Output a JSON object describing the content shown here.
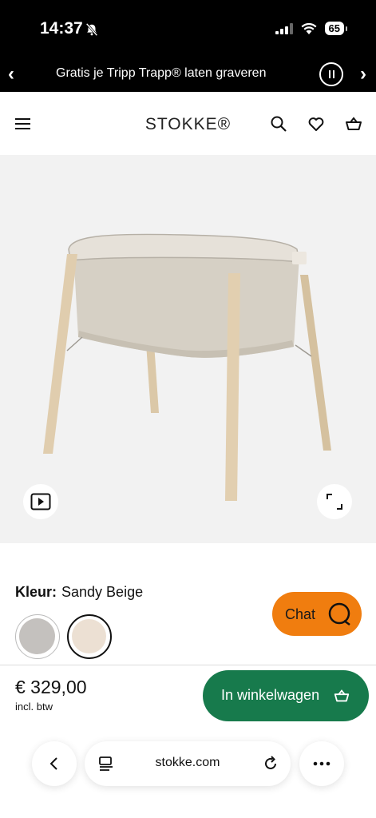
{
  "status_bar": {
    "time": "14:37",
    "battery": "65"
  },
  "promo": {
    "text": "Gratis je Tripp Trapp® laten graveren",
    "prev": "‹",
    "next": "›"
  },
  "header": {
    "logo": "STOKKE®"
  },
  "product": {
    "color_label": "Kleur:",
    "color_value": "Sandy Beige",
    "swatches": [
      {
        "name": "grey",
        "color": "#c4c1be"
      },
      {
        "name": "sandy-beige",
        "color": "#ece0d3",
        "selected": true
      }
    ]
  },
  "chat": {
    "label": "Chat",
    "color": "#f07d0f"
  },
  "purchase": {
    "price": "€ 329,00",
    "tax_note": "incl. btw",
    "cart_label": "In winkelwagen",
    "button_color": "#177a4c"
  },
  "browser": {
    "url": "stokke.com"
  }
}
